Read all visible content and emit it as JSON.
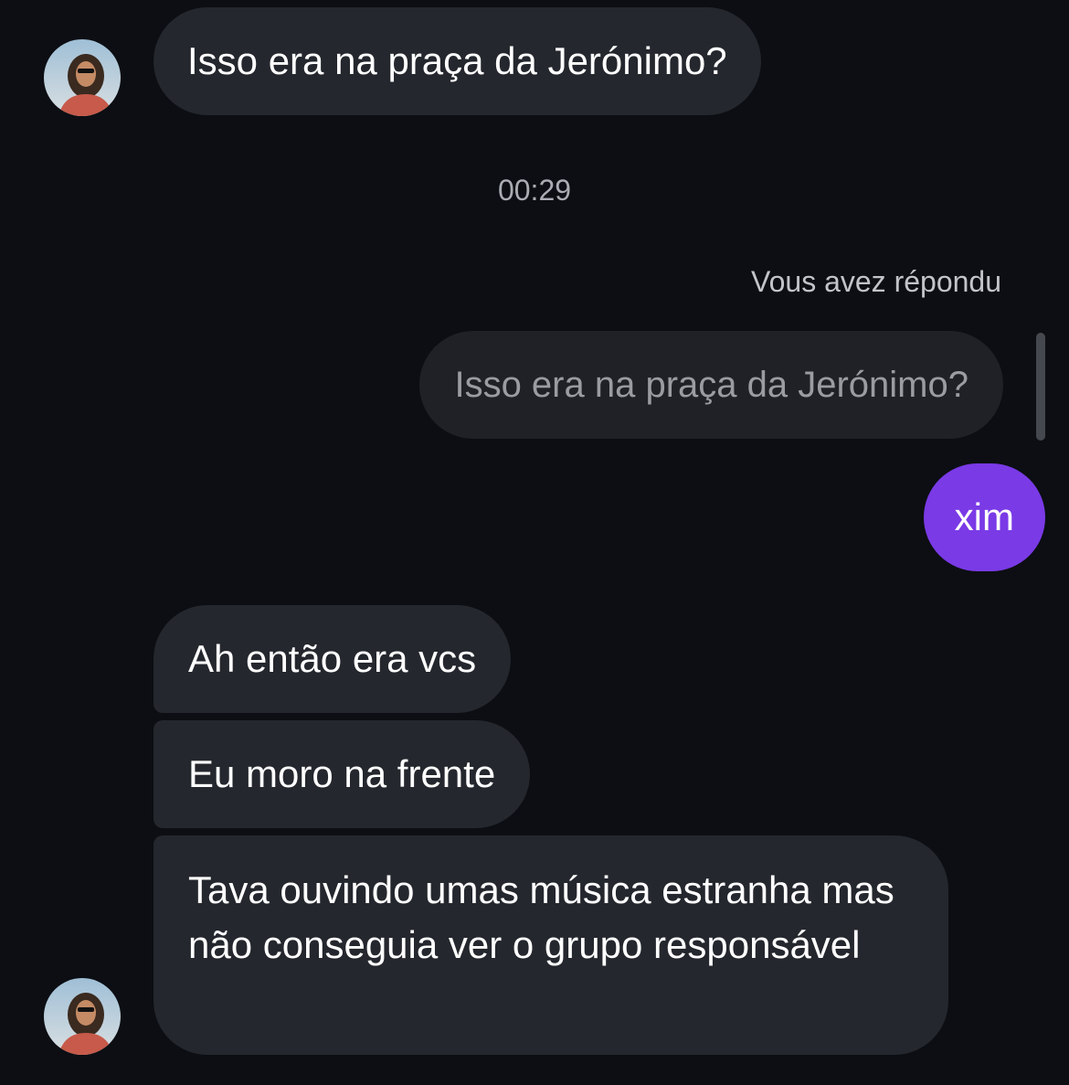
{
  "conversation": {
    "incoming_top": {
      "text": "Isso era na praça da Jerónimo?"
    },
    "timestamp": "00:29",
    "reply": {
      "label": "Vous avez répondu",
      "quoted_text": "Isso era na praça da Jerónimo?",
      "outgoing_text": "xim"
    },
    "incoming_group": [
      {
        "text": "Ah então era vcs"
      },
      {
        "text": "Eu moro na frente"
      },
      {
        "text": "Tava ouvindo umas música estranha mas não conseguia ver o grupo responsável"
      }
    ]
  },
  "colors": {
    "background": "#0c0e13",
    "incoming_bubble": "#24272d",
    "quoted_bubble": "#1f2126",
    "outgoing_bubble": "#7a3ae6",
    "muted_text": "#a9acb3"
  },
  "icons": {
    "avatar": "contact-avatar-photo"
  }
}
